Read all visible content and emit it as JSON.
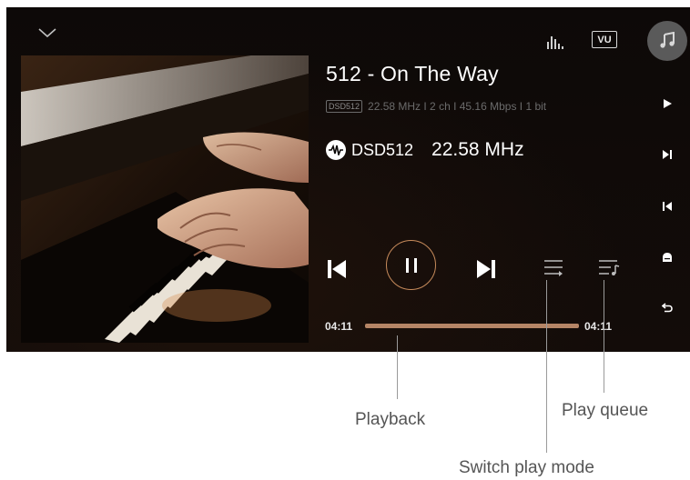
{
  "track": {
    "title": "512 - On The Way",
    "badge": "DSD512",
    "details": "22.58 MHz  I  2 ch  I  45.16 Mbps  I  1 bit",
    "format": "DSD512",
    "sample_rate": "22.58 MHz"
  },
  "header": {
    "vu_label": "VU"
  },
  "progress": {
    "elapsed": "04:11",
    "duration": "04:11",
    "fraction": 1.0
  },
  "icons": {
    "collapse": "chevron-down-icon",
    "eq": "equalizer-icon",
    "vu": "vu-meter-icon",
    "music": "music-note-icon",
    "prev": "skip-previous-icon",
    "play_pause": "pause-icon",
    "next": "skip-next-icon",
    "mode": "play-mode-icon",
    "queue": "play-queue-icon"
  },
  "sidebar": {
    "items": [
      "play-icon",
      "skip-next-icon",
      "skip-previous-icon",
      "home-icon",
      "back-icon"
    ]
  },
  "callouts": {
    "playback": "Playback",
    "switch_mode": "Switch play mode",
    "queue": "Play queue"
  },
  "colors": {
    "accent": "#c68a5b",
    "progress_fill": "#b58566",
    "background": "#0a0706"
  }
}
